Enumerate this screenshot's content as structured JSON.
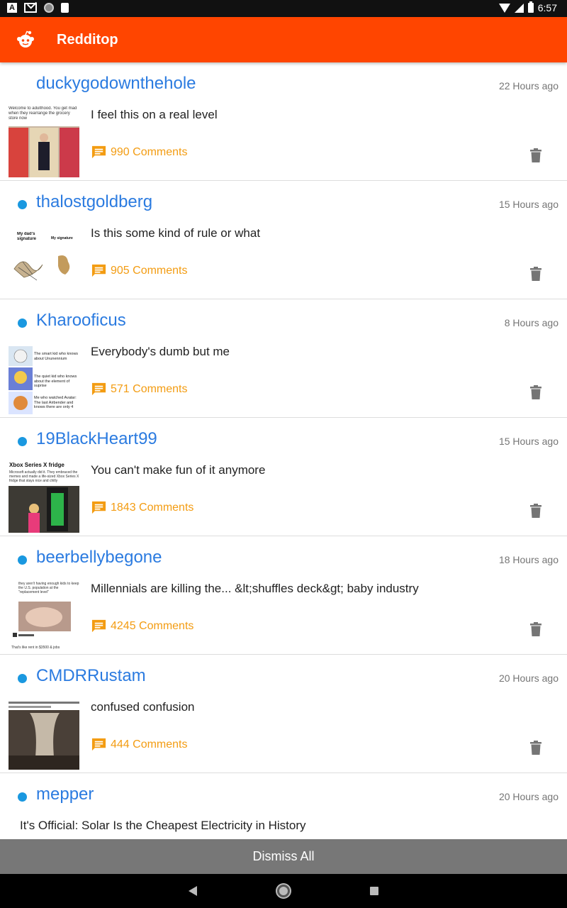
{
  "status_bar": {
    "time": "6:57",
    "notif_a": "A"
  },
  "app_bar": {
    "title": "Redditop"
  },
  "posts": [
    {
      "author": "duckygodownthehole",
      "time": "22 Hours ago",
      "title": "I feel this on a real level",
      "comments": "990 Comments",
      "unread": false,
      "thumb_text": "Welcome to adulthood. You get mad when they rearrange the grocery store now"
    },
    {
      "author": "thalostgoldberg",
      "time": "15 Hours ago",
      "title": "Is this some kind of rule or what",
      "comments": "905 Comments",
      "unread": true,
      "thumb_text_a": "My dad's signature",
      "thumb_text_b": "My signature"
    },
    {
      "author": "Kharooficus",
      "time": "8 Hours ago",
      "title": "Everybody's dumb but me",
      "comments": "571 Comments",
      "unread": true,
      "thumb_text_a": "The smart kid who knows about Ununennium",
      "thumb_text_b": "The quiet kid who knows about the element of suprise",
      "thumb_text_c": "Me who watched Avatar: The last Airbender and knows there are only 4"
    },
    {
      "author": "19BlackHeart99",
      "time": "15 Hours ago",
      "title": "You can't make fun of it anymore",
      "comments": "1843 Comments",
      "unread": true,
      "thumb_text_a": "Xbox Series X fridge",
      "thumb_text_b": "Microsoft actually did it. They embraced the memes and made a life-sized Xbox Series X fridge that stays nice and chilly"
    },
    {
      "author": "beerbellybegone",
      "time": "18 Hours ago",
      "title": "Millennials are killing the... &lt;shuffles deck&gt; baby industry",
      "comments": "4245 Comments",
      "unread": true,
      "thumb_text_a": "they aren't having enough kids to keep the U.S. population at the \"replacement level\"",
      "thumb_text_b": "That's like rent in $3500 & jobs"
    },
    {
      "author": "CMDRRustam",
      "time": "20 Hours ago",
      "title": "confused confusion",
      "comments": "444 Comments",
      "unread": true
    },
    {
      "author": "mepper",
      "time": "20 Hours ago",
      "title": "It's Official: Solar Is the Cheapest Electricity in History",
      "comments": "",
      "unread": true
    }
  ],
  "dismiss_label": "Dismiss All",
  "colors": {
    "accent": "#ff4500",
    "author": "#2b7be0",
    "comments": "#f39c12",
    "unread_dot": "#1a98e0"
  }
}
